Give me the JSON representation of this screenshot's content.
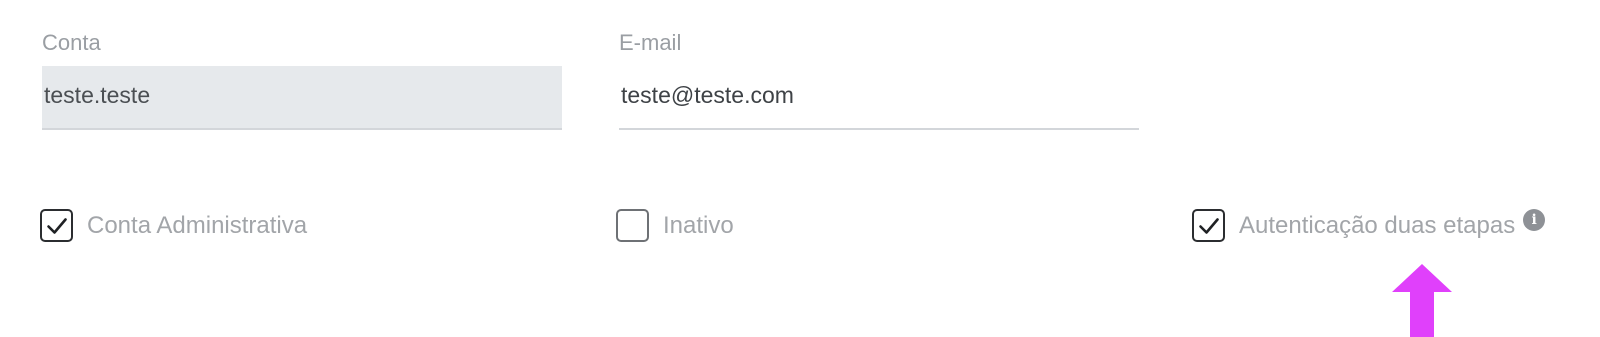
{
  "account": {
    "label": "Conta",
    "value": "teste.teste"
  },
  "email": {
    "label": "E-mail",
    "value": "teste@teste.com"
  },
  "checkboxes": {
    "admin": {
      "label": "Conta Administrativa",
      "checked": true
    },
    "inactive": {
      "label": "Inativo",
      "checked": false
    },
    "two_factor": {
      "label": "Autenticação duas etapas",
      "checked": true
    }
  },
  "icons": {
    "info": "info-icon",
    "checkmark": "checkmark-icon",
    "arrow": "arrow-up-icon"
  },
  "colors": {
    "pointer_arrow": "#e040fb",
    "readonly_bg": "#e6e9ec",
    "label": "#9a9ea3"
  }
}
